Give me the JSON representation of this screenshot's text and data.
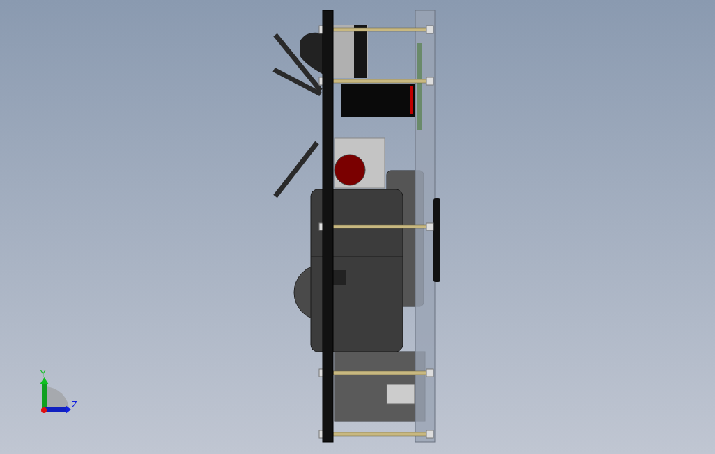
{
  "triad": {
    "axes": [
      {
        "label": "Y"
      },
      {
        "label": "Z"
      }
    ]
  }
}
